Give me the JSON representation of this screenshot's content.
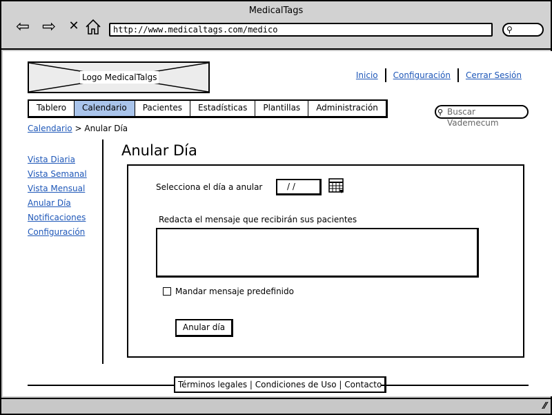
{
  "window": {
    "title": "MedicalTags",
    "url": "http://www.medicaltags.com/medico"
  },
  "chrome_icons": {
    "back": "back-arrow-icon",
    "forward": "forward-arrow-icon",
    "stop": "close-icon",
    "home": "home-icon",
    "search": "search-icon"
  },
  "logo": {
    "label": "Logo MedicalTalgs"
  },
  "top_links": [
    "Inicio",
    "Configuración",
    "Cerrar Sesión"
  ],
  "tabs": [
    {
      "label": "Tablero"
    },
    {
      "label": "Calendario",
      "active": true
    },
    {
      "label": "Pacientes"
    },
    {
      "label": "Estadísticas"
    },
    {
      "label": "Plantillas"
    },
    {
      "label": "Administración"
    }
  ],
  "search": {
    "placeholder": "Buscar Vademecum"
  },
  "breadcrumb": {
    "parent": "Calendario",
    "separator": ">",
    "current": "Anular Día"
  },
  "sidebar": [
    "Vista Diaria",
    "Vista Semanal",
    "Vista Mensual",
    "Anular Día",
    "Notificaciones",
    "Configuración"
  ],
  "main": {
    "title": "Anular Día",
    "date_label": "Selecciona el día a anular",
    "date_value": "/ /",
    "message_label": "Redacta el mensaje que recibirán sus pacientes",
    "message_value": "",
    "checkbox_label": "Mandar mensaje predefinido",
    "checkbox_checked": false,
    "button_label": "Anular día"
  },
  "footer": {
    "links": [
      "Términos legales",
      "Condiciones de Uso",
      "Contacto"
    ],
    "separator": "|"
  },
  "colors": {
    "accent_link": "#1e57b8",
    "active_tab": "#a9c4eb",
    "chrome": "#c8c8c8"
  }
}
